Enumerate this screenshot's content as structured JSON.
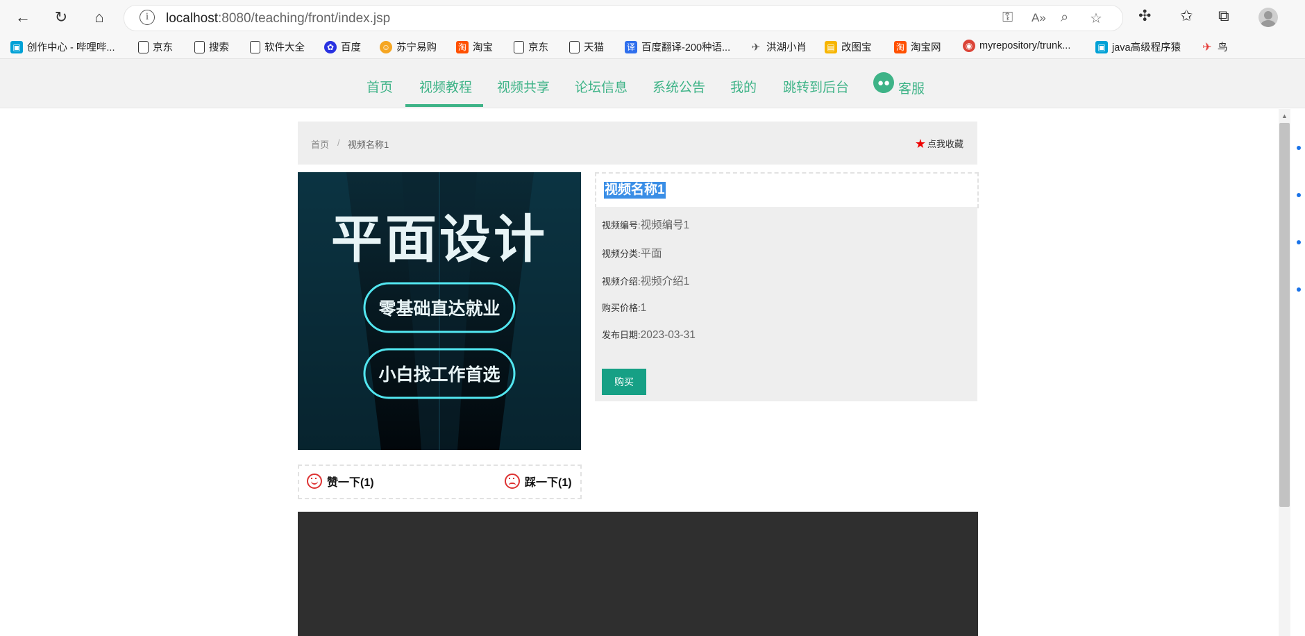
{
  "browser": {
    "url_host": "localhost",
    "url_path": ":8080/teaching/front/index.jsp"
  },
  "bookmarks": [
    {
      "label": "创作中心 - 哔哩哔...",
      "icon": "bilibili-icon",
      "color": "#00a1d6"
    },
    {
      "label": "京东",
      "icon": "page-icon"
    },
    {
      "label": "搜索",
      "icon": "page-icon"
    },
    {
      "label": "软件大全",
      "icon": "page-icon"
    },
    {
      "label": "百度",
      "icon": "baidu-icon",
      "color": "#2932e1"
    },
    {
      "label": "苏宁易购",
      "icon": "suning-icon",
      "color": "#f5a623"
    },
    {
      "label": "淘宝",
      "icon": "taobao-icon",
      "color": "#ff5000"
    },
    {
      "label": "京东",
      "icon": "page-icon"
    },
    {
      "label": "天猫",
      "icon": "page-icon"
    },
    {
      "label": "百度翻译-200种语...",
      "icon": "translate-icon",
      "color": "#2f6fed"
    },
    {
      "label": "洪湖小肖",
      "icon": "bird-icon",
      "color": "#555555"
    },
    {
      "label": "改图宝",
      "icon": "gaitubao-icon",
      "color": "#f7b500"
    },
    {
      "label": "淘宝网",
      "icon": "taobao-icon",
      "color": "#ff5000"
    },
    {
      "label": "myrepository/trunk...",
      "icon": "chrome-icon",
      "color": "#db4437"
    },
    {
      "label": "java高级程序猿",
      "icon": "bilibili-icon",
      "color": "#00a1d6"
    },
    {
      "label": "鸟",
      "icon": "bird-red-icon",
      "color": "#e53935"
    }
  ],
  "nav": {
    "items": [
      "首页",
      "视频教程",
      "视频共享",
      "论坛信息",
      "系统公告",
      "我的",
      "跳转到后台"
    ],
    "active": "视频教程",
    "service": "客服",
    "accent": "#3eb387"
  },
  "breadcrumb": {
    "home": "首页",
    "separator": "/",
    "current": "视频名称1",
    "favorite": "点我收藏"
  },
  "poster": {
    "title": "平面设计",
    "badge1": "零基础直达就业",
    "badge2": "小白找工作首选"
  },
  "video": {
    "title": "视频名称1",
    "fields": [
      {
        "label": "视频编号:",
        "value": "视频编号1"
      },
      {
        "label": "视频分类:",
        "value": "平面"
      },
      {
        "label": "视频介绍:",
        "value": "视频介绍1"
      },
      {
        "label": "购买价格:",
        "value": "1"
      },
      {
        "label": "发布日期:",
        "value": "2023-03-31"
      }
    ],
    "buy_label": "购买"
  },
  "votes": {
    "like": "赞一下(1)",
    "dislike": "踩一下(1)"
  }
}
